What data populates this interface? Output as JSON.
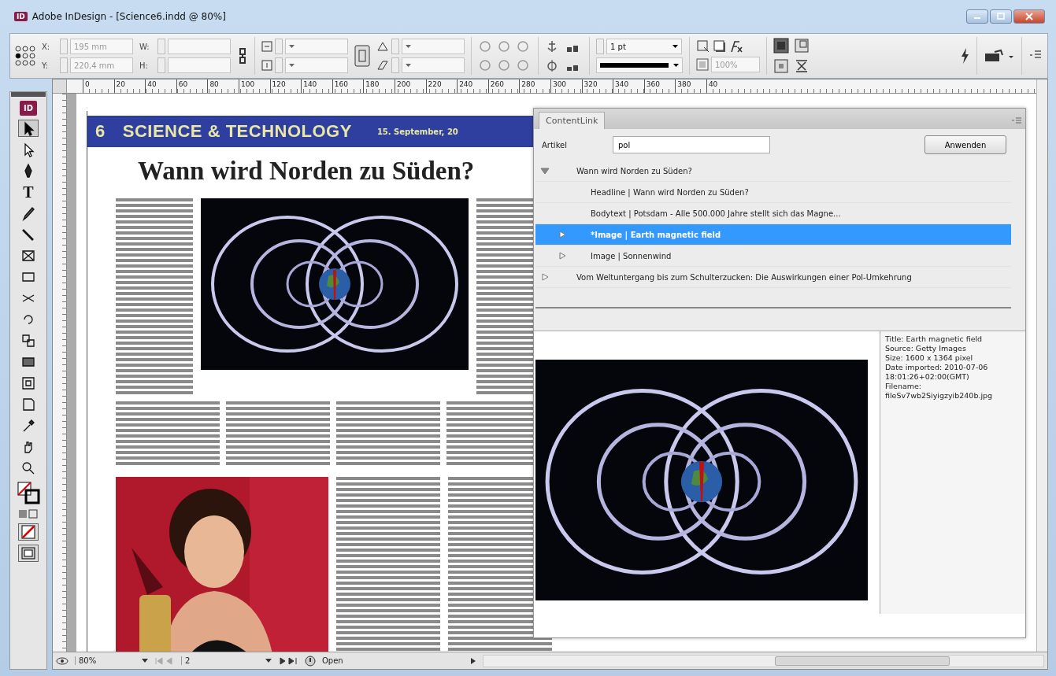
{
  "window": {
    "logo": "ID",
    "title": "Adobe InDesign - [Science6.indd @ 80%]"
  },
  "control_bar": {
    "x_label": "X:",
    "x_value": "195 mm",
    "y_label": "Y:",
    "y_value": "220,4 mm",
    "w_label": "W:",
    "h_label": "H:",
    "stroke_weight": "1 pt",
    "opacity": "100%"
  },
  "toolbox": {
    "logo": "ID",
    "type_tool": "T"
  },
  "ruler": {
    "marks": [
      "0",
      "20",
      "40",
      "60",
      "80",
      "100",
      "120",
      "140",
      "160",
      "180",
      "200",
      "220",
      "240",
      "260",
      "280",
      "300",
      "320",
      "340",
      "360",
      "380",
      "40"
    ]
  },
  "page": {
    "page_number": "6",
    "section": "SCIENCE & TECHNOLOGY",
    "date": "15. September, 20",
    "headline": "Wann wird Norden zu Süden?"
  },
  "content_link": {
    "tab": "ContentLink",
    "filter_label": "Artikel",
    "filter_value": "pol",
    "apply_button": "Anwenden",
    "tree": [
      {
        "label": "Wann wird Norden zu Süden?",
        "expanded": true,
        "selected": false,
        "children": [
          {
            "label": "Headline | Wann wird Norden zu Süden?",
            "selected": false
          },
          {
            "label": "Bodytext | Potsdam - Alle 500.000 Jahre stellt sich das Magne...",
            "selected": false
          },
          {
            "label": "*Image | Earth magnetic field",
            "expanded": false,
            "selected": true
          },
          {
            "label": "Image | Sonnenwind",
            "expanded": false,
            "selected": false
          }
        ]
      },
      {
        "label": "Vom Weltuntergang bis zum Schulterzucken: Die Auswirkungen einer Pol-Umkehrung",
        "expanded": false,
        "selected": false
      }
    ],
    "metadata": [
      "Title: Earth magnetic field",
      "Source: Getty Images",
      "Size: 1600 x 1364 pixel",
      "Date imported: 2010-07-06",
      "18:01:26+02:00(GMT)",
      "Filename:",
      "fileSv7wb2Siyigzyib240b.jpg"
    ]
  },
  "status_bar": {
    "zoom": "80%",
    "page": "2",
    "status": "Open"
  }
}
